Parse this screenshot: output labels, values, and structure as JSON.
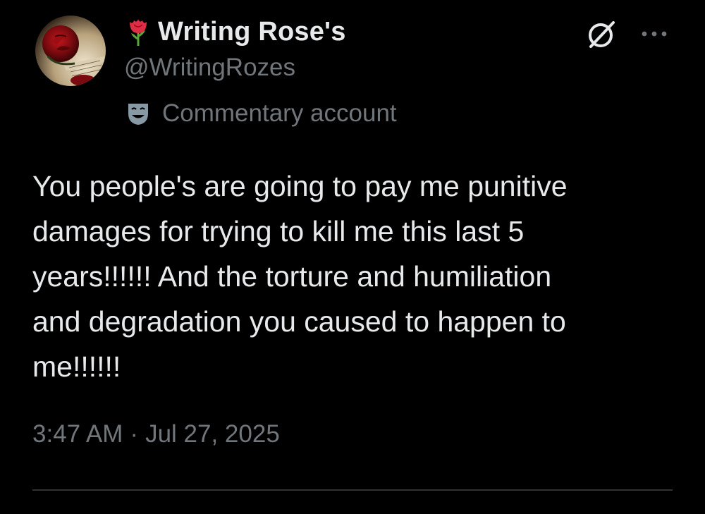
{
  "tweet": {
    "author": {
      "display_name": "Writing Rose's",
      "handle": "@WritingRozes",
      "name_emoji": "rose-emoji",
      "avatar": "rose-on-letter-avatar"
    },
    "label": {
      "icon": "performing-arts-mask-icon",
      "text": "Commentary account"
    },
    "actions": {
      "grok_icon": "grok-icon",
      "more_icon": "more-horizontal-icon"
    },
    "text": "You people's are going to pay me punitive\ndamages for trying to kill me this last 5\nyears!!!!!! And the torture and humiliation\nand degradation you caused to happen to\nme!!!!!!",
    "time": "3:47 AM",
    "separator": "·",
    "date": "Jul 27, 2025"
  },
  "colors": {
    "background": "#000000",
    "primary_text": "#e7e9ea",
    "secondary_text": "#71767b",
    "divider": "#2f3336"
  }
}
